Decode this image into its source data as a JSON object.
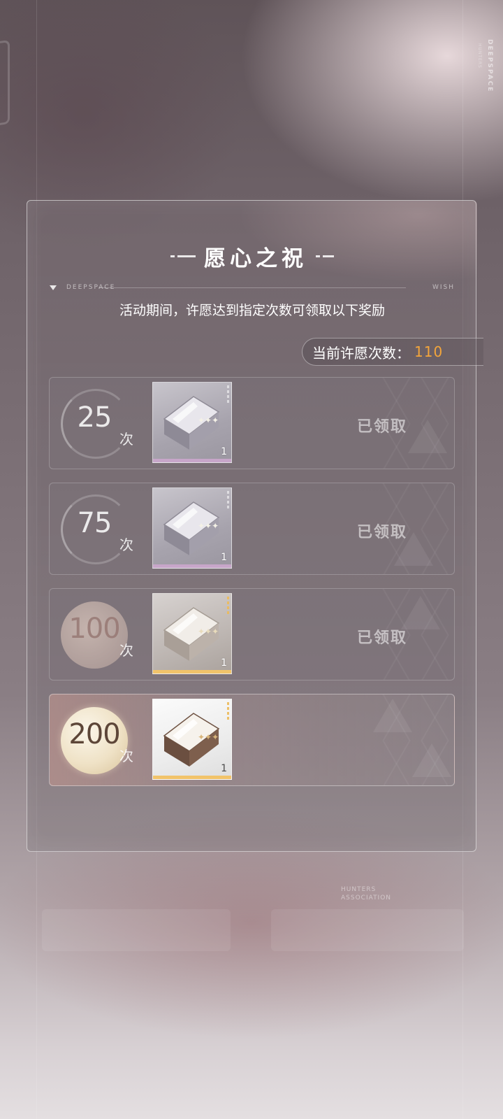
{
  "background": {
    "brand_vertical": "DEEPSPACE",
    "brand_sub": "HUNTERS",
    "hunter_text_line1": "HUNTERS",
    "hunter_text_line2": "ASSOCIATION"
  },
  "panel": {
    "title": "愿心之祝",
    "deco_left": "DEEPSPACE",
    "deco_right": "WISH",
    "subtitle": "活动期间，许愿达到指定次数可领取以下奖励",
    "wish_count_label": "当前许愿次数：",
    "wish_count_value": "110"
  },
  "colors": {
    "accent_orange": "#f3a53b",
    "purple_rarity": "#c7a6c9",
    "gold_rarity": "#f1c36a"
  },
  "rewards": [
    {
      "threshold": "25",
      "unit": "次",
      "item_count": "1",
      "status": "已领取",
      "claimed": true,
      "item_icon": "gift-box-icon",
      "rarity": "purple"
    },
    {
      "threshold": "75",
      "unit": "次",
      "item_count": "1",
      "status": "已领取",
      "claimed": true,
      "item_icon": "gift-box-icon",
      "rarity": "purple"
    },
    {
      "threshold": "100",
      "unit": "次",
      "item_count": "1",
      "status": "已领取",
      "claimed": true,
      "item_icon": "gift-box-icon",
      "rarity": "gold"
    },
    {
      "threshold": "200",
      "unit": "次",
      "item_count": "1",
      "status": "",
      "claimed": false,
      "item_icon": "gift-box-icon",
      "rarity": "gold"
    }
  ]
}
